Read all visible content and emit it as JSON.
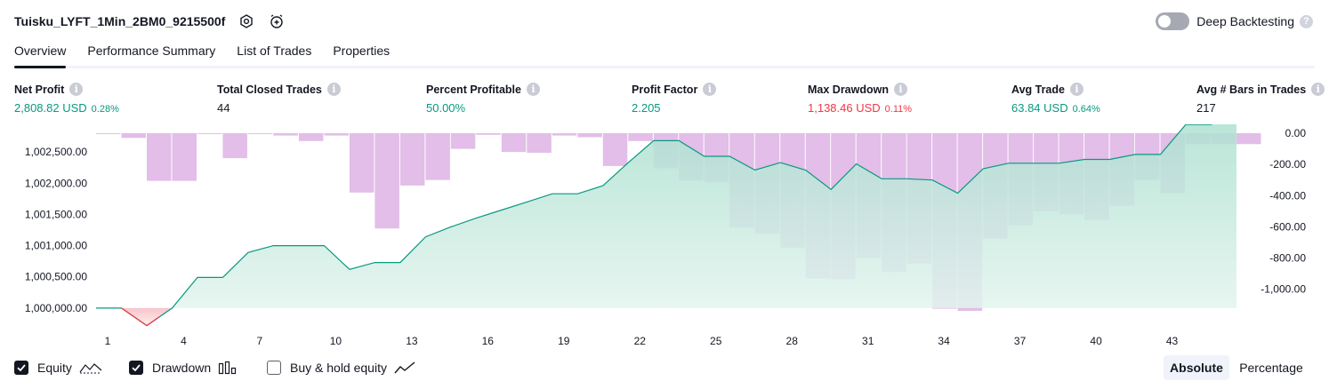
{
  "header": {
    "title": "Tuisku_LYFT_1Min_2BM0_9215500f",
    "deep_backtesting_label": "Deep Backtesting",
    "help_glyph": "?"
  },
  "tabs": [
    {
      "label": "Overview",
      "active": true
    },
    {
      "label": "Performance Summary",
      "active": false
    },
    {
      "label": "List of Trades",
      "active": false
    },
    {
      "label": "Properties",
      "active": false
    }
  ],
  "metrics": [
    {
      "label": "Net Profit",
      "value": "2,808.82 USD",
      "pct": "0.28%",
      "color": "#089981"
    },
    {
      "label": "Total Closed Trades",
      "value": "44",
      "pct": "",
      "color": "#131722"
    },
    {
      "label": "Percent Profitable",
      "value": "50.00%",
      "pct": "",
      "color": "#089981"
    },
    {
      "label": "Profit Factor",
      "value": "2.205",
      "pct": "",
      "color": "#089981"
    },
    {
      "label": "Max Drawdown",
      "value": "1,138.46 USD",
      "pct": "0.11%",
      "color": "#f23645"
    },
    {
      "label": "Avg Trade",
      "value": "63.84 USD",
      "pct": "0.64%",
      "color": "#089981"
    },
    {
      "label": "Avg # Bars in Trades",
      "value": "217",
      "pct": "",
      "color": "#131722"
    }
  ],
  "info_glyph": "i",
  "chart_data": {
    "type": "area",
    "x_ticks": [
      "1",
      "4",
      "7",
      "10",
      "13",
      "16",
      "19",
      "22",
      "25",
      "28",
      "31",
      "34",
      "37",
      "40",
      "43"
    ],
    "y_left_ticks": [
      "1,000,000.00",
      "1,000,500.00",
      "1,001,000.00",
      "1,001,500.00",
      "1,002,000.00",
      "1,002,500.00"
    ],
    "y_right_ticks": [
      "0.00",
      "-200.00",
      "-400.00",
      "-600.00",
      "-800.00",
      "-1,000.00"
    ],
    "y_left_range": [
      999700,
      1002800
    ],
    "y_right_range": [
      -1138.46,
      0
    ],
    "x_range": [
      1,
      46
    ],
    "series": [
      {
        "name": "Equity",
        "color": "#089981",
        "x": [
          1,
          2,
          3,
          4,
          5,
          6,
          7,
          8,
          9,
          10,
          11,
          12,
          13,
          14,
          15,
          16,
          17,
          18,
          19,
          20,
          21,
          22,
          23,
          24,
          25,
          26,
          27,
          28,
          29,
          30,
          31,
          32,
          33,
          34,
          35,
          36,
          37,
          38,
          39,
          40,
          41,
          42,
          43,
          44,
          45,
          46
        ],
        "values": [
          1000000,
          1000000,
          999720,
          1000000,
          1000490,
          1000490,
          1000890,
          1001000,
          1001000,
          1001000,
          1000620,
          1000730,
          1000730,
          1001140,
          1001300,
          1001440,
          1001570,
          1001700,
          1001830,
          1001830,
          1001960,
          1002330,
          1002680,
          1002680,
          1002430,
          1002430,
          1002210,
          1002330,
          1002210,
          1001900,
          1002310,
          1002070,
          1002070,
          1002050,
          1001840,
          1002230,
          1002320,
          1002320,
          1002320,
          1002380,
          1002380,
          1002460,
          1002460,
          1002940,
          1002940,
          1003170
        ]
      },
      {
        "name": "Drawdown",
        "color": "#ce93d8",
        "x": [
          1,
          2,
          3,
          4,
          5,
          6,
          7,
          8,
          9,
          10,
          11,
          12,
          13,
          14,
          15,
          16,
          17,
          18,
          19,
          20,
          21,
          22,
          23,
          24,
          25,
          26,
          27,
          28,
          29,
          30,
          31,
          32,
          33,
          34,
          35,
          36,
          37,
          38,
          39,
          40,
          41,
          42,
          43,
          44,
          45,
          46
        ],
        "values": [
          -5,
          -30,
          -305,
          -305,
          -5,
          -160,
          -5,
          -15,
          -50,
          -15,
          -380,
          -610,
          -335,
          -300,
          -100,
          -10,
          -120,
          -125,
          -15,
          -25,
          -210,
          -50,
          -225,
          -305,
          -315,
          -605,
          -645,
          -735,
          -930,
          -935,
          -800,
          -890,
          -835,
          -1125,
          -1138.46,
          -675,
          -590,
          -500,
          -520,
          -555,
          -465,
          -300,
          -385,
          -70,
          -70,
          -70
        ]
      }
    ]
  },
  "legend": [
    {
      "label": "Equity",
      "checked": true,
      "icon": "equity-line-icon"
    },
    {
      "label": "Drawdown",
      "checked": true,
      "icon": "drawdown-bars-icon"
    },
    {
      "label": "Buy & hold equity",
      "checked": false,
      "icon": "buy-hold-line-icon"
    }
  ],
  "scale_toggle": {
    "absolute": "Absolute",
    "percentage": "Percentage",
    "active": "Absolute"
  }
}
